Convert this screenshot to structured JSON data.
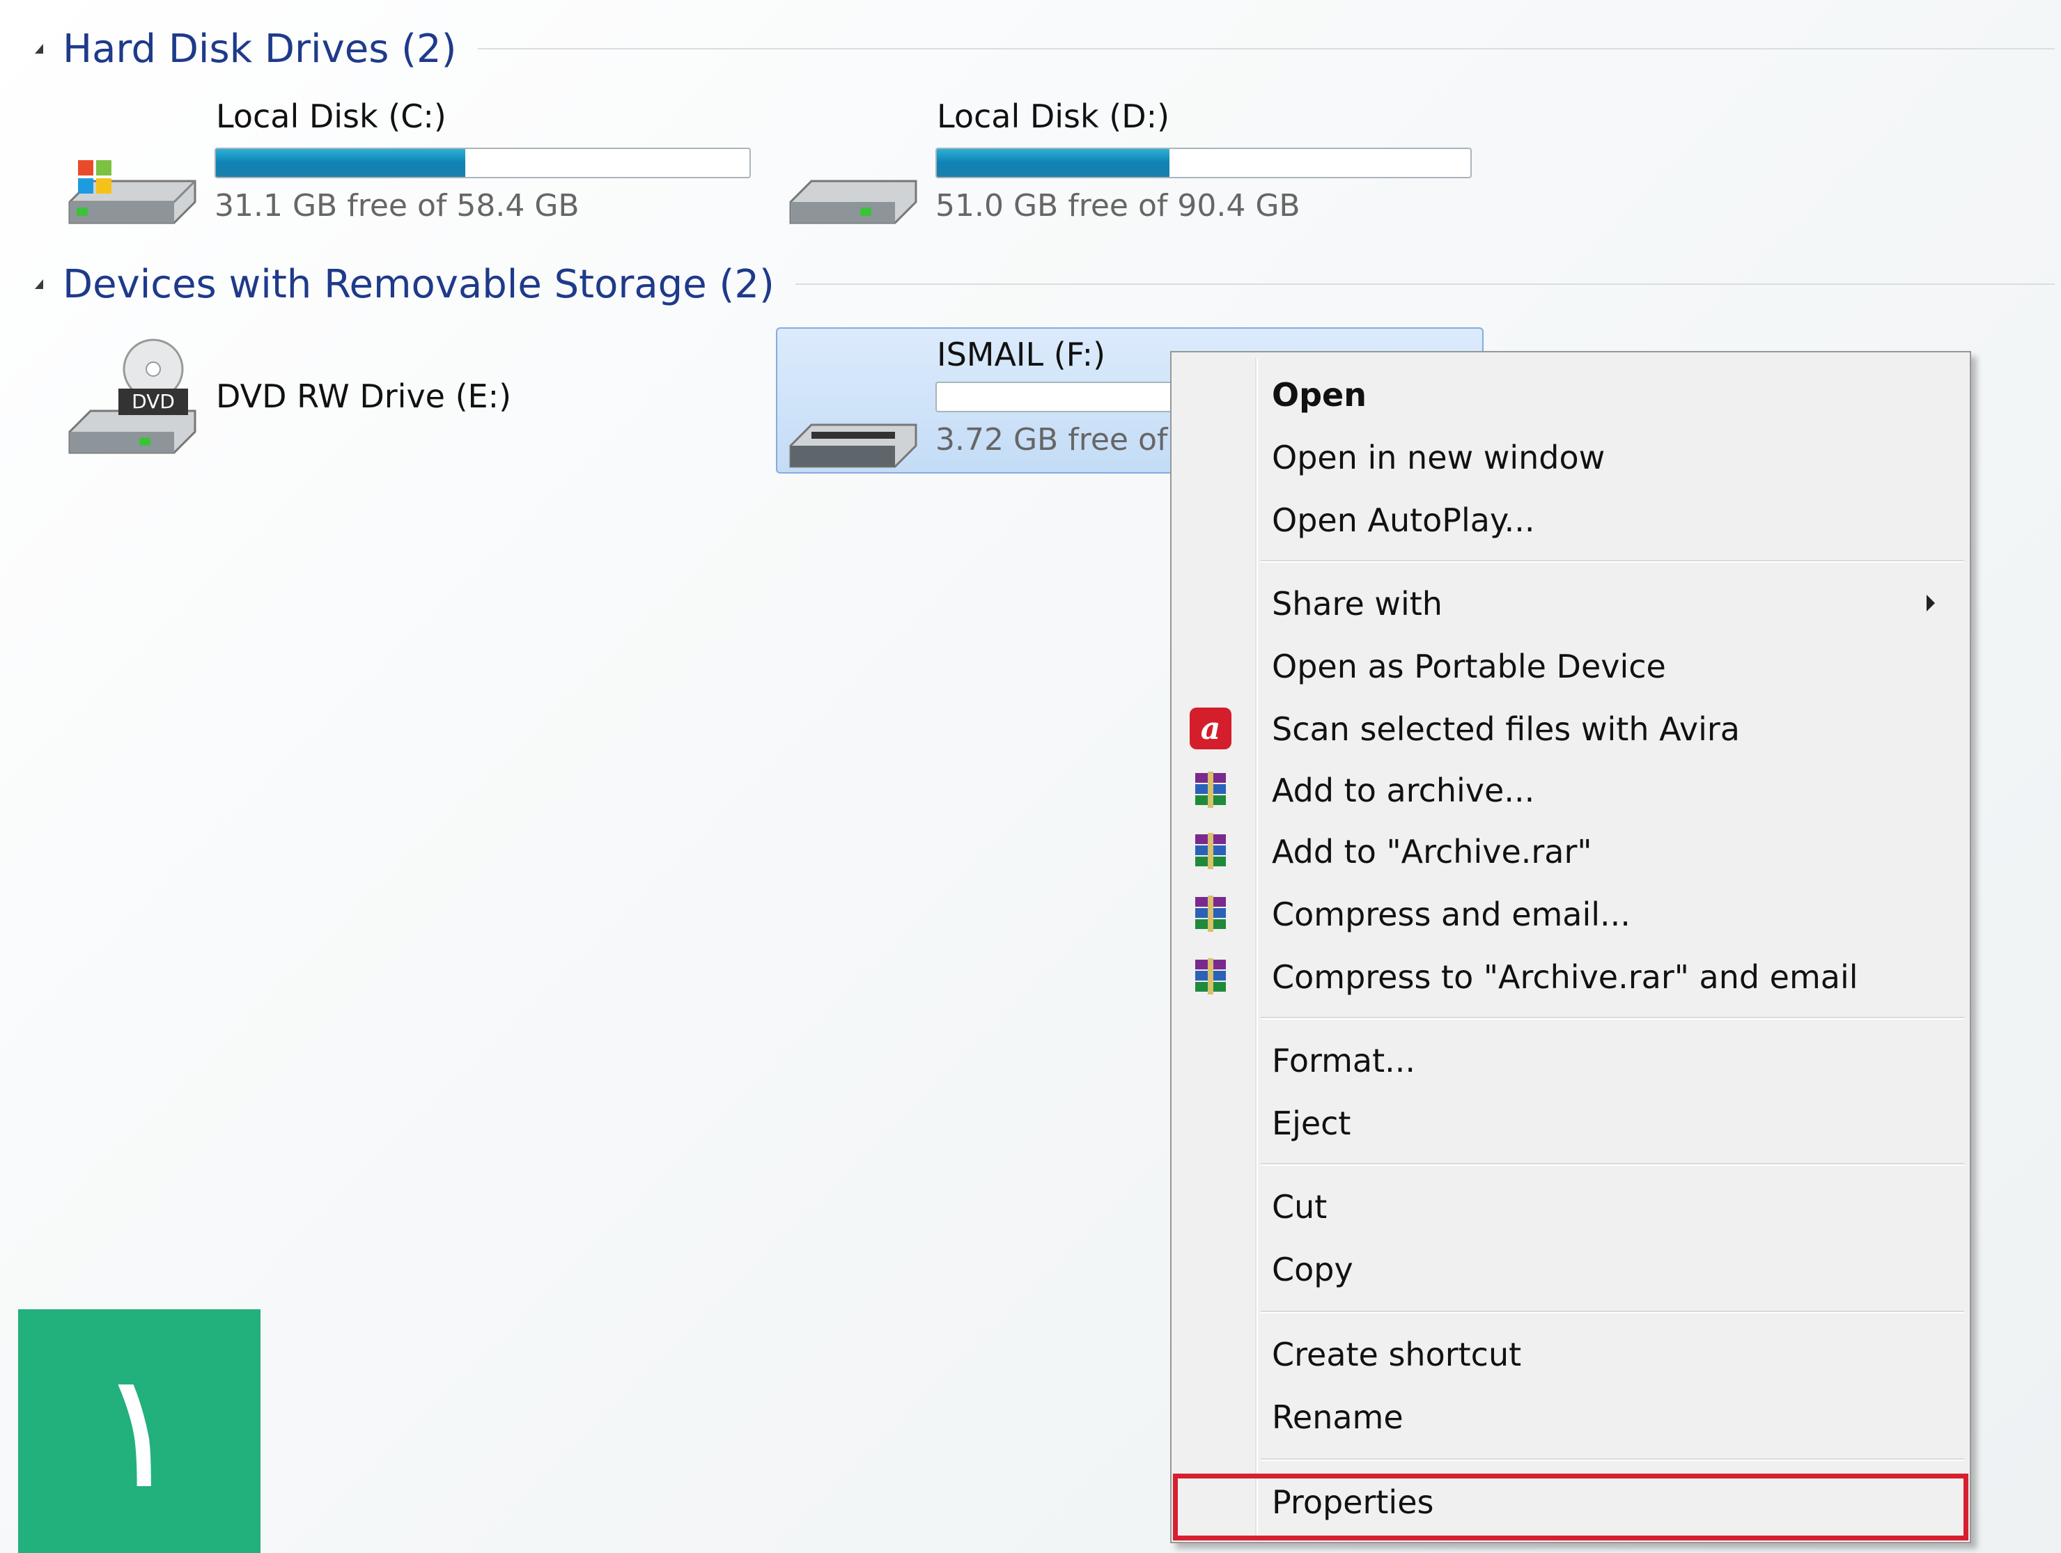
{
  "groups": {
    "hdd": {
      "title": "Hard Disk Drives (2)"
    },
    "removable": {
      "title": "Devices with Removable Storage (2)"
    }
  },
  "drives": {
    "c": {
      "name": "Local Disk (C:)",
      "free": "31.1 GB free of 58.4 GB",
      "used_fraction": 0.467
    },
    "d": {
      "name": "Local Disk (D:)",
      "free": "51.0 GB free of 90.4 GB",
      "used_fraction": 0.436
    },
    "e": {
      "name": "DVD RW Drive (E:)",
      "label": "DVD"
    },
    "f": {
      "name": "ISMAIL (F:)",
      "free": "3.72 GB free of 3",
      "used_fraction": 0.0
    }
  },
  "context_menu": {
    "items": [
      {
        "label": "Open",
        "bold": true
      },
      {
        "label": "Open in new window"
      },
      {
        "label": "Open AutoPlay..."
      },
      {
        "label": "Share with",
        "submenu": true
      },
      {
        "label": "Open as Portable Device"
      },
      {
        "label": "Scan selected files with Avira",
        "icon": "avira-icon"
      },
      {
        "label": "Add to archive...",
        "icon": "winrar-icon"
      },
      {
        "label": "Add to \"Archive.rar\"",
        "icon": "winrar-icon"
      },
      {
        "label": "Compress and email...",
        "icon": "winrar-icon"
      },
      {
        "label": "Compress to \"Archive.rar\" and email",
        "icon": "winrar-icon"
      },
      {
        "label": "Format..."
      },
      {
        "label": "Eject"
      },
      {
        "label": "Cut"
      },
      {
        "label": "Copy"
      },
      {
        "label": "Create shortcut"
      },
      {
        "label": "Rename"
      },
      {
        "label": "Properties",
        "highlighted": true
      }
    ]
  },
  "badge": {
    "text": "١"
  },
  "colors": {
    "accent": "#1e3a8a",
    "highlight": "#d7202f",
    "badge": "#22b07c",
    "bar_fill": "#1b8fbd"
  }
}
